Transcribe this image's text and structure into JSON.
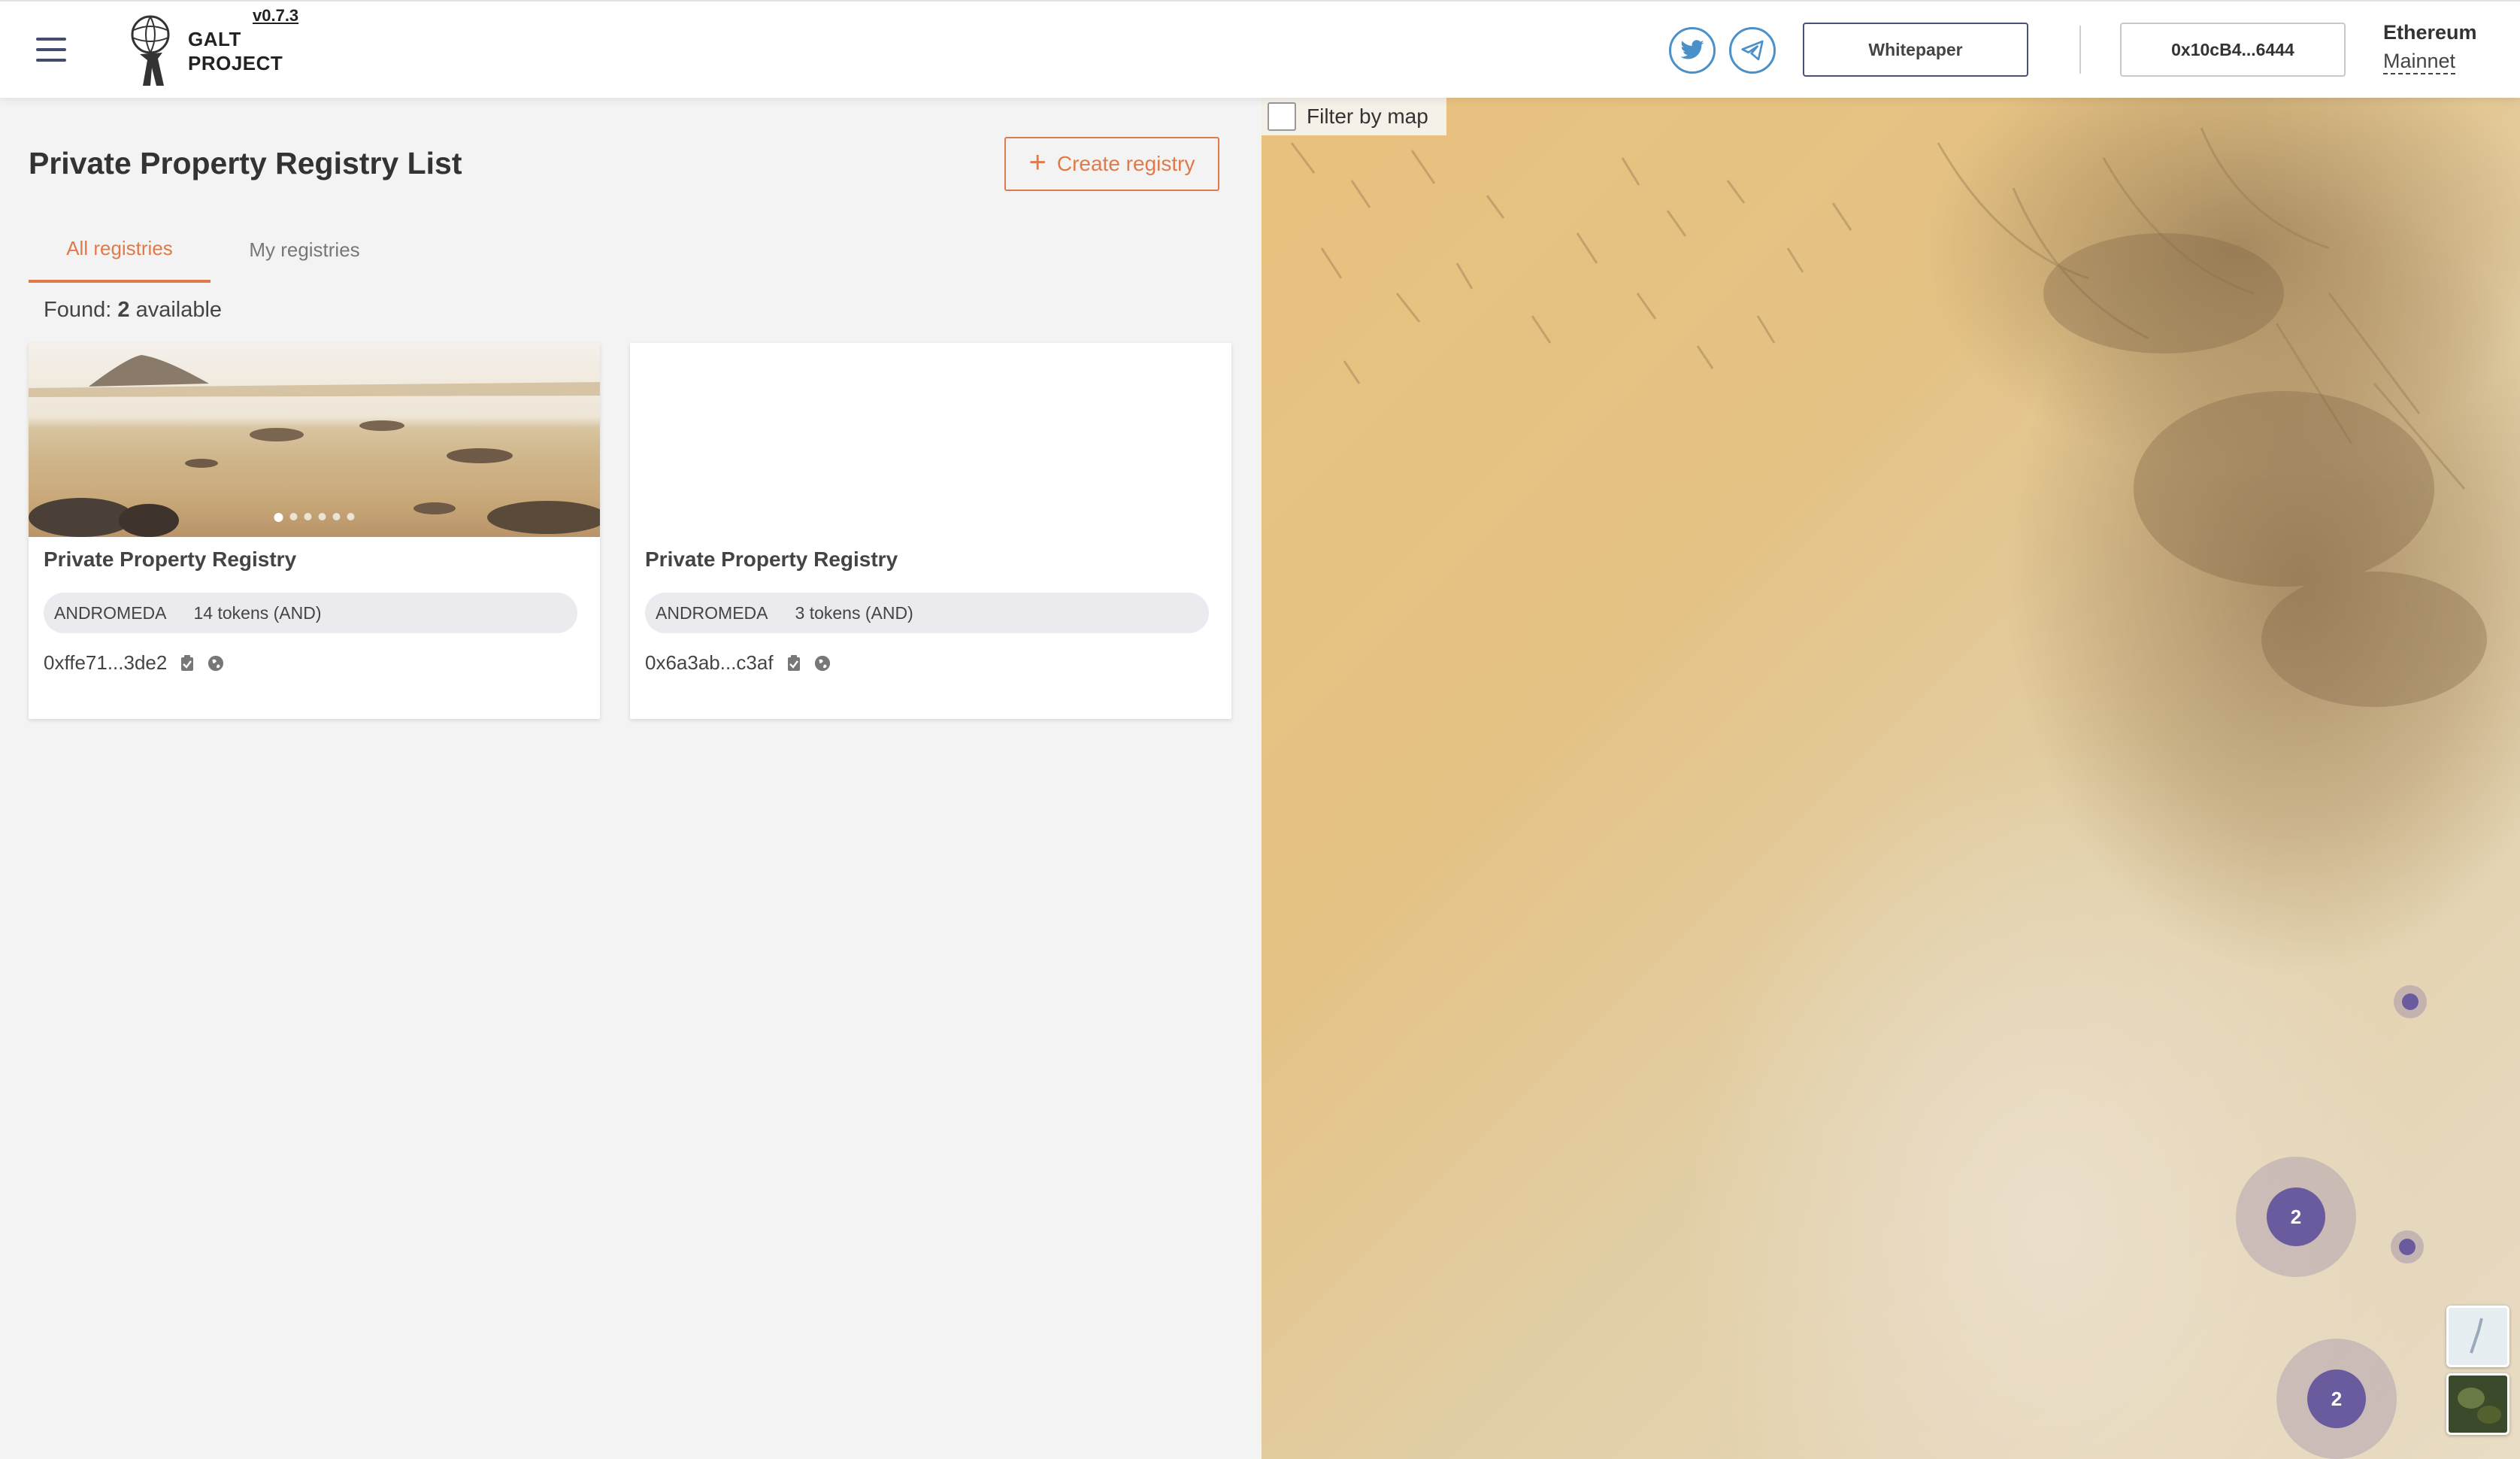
{
  "app": {
    "version": "v0.7.3",
    "logo_line1": "GALT",
    "logo_line2": "PROJECT"
  },
  "header": {
    "whitepaper_label": "Whitepaper",
    "account_label": "0x10cB4...6444",
    "network_title": "Ethereum",
    "network_name": "Mainnet",
    "icons": [
      "menu-icon",
      "twitter-icon",
      "telegram-icon"
    ]
  },
  "main": {
    "title": "Private Property Registry List",
    "create_label": "Create registry",
    "tabs": [
      {
        "label": "All registries",
        "active": true
      },
      {
        "label": "My registries",
        "active": false
      }
    ],
    "found_prefix": "Found:",
    "found_count": "2",
    "found_suffix": "available",
    "cards": [
      {
        "title": "Private Property Registry",
        "network": "ANDROMEDA",
        "tokens": "14 tokens (AND)",
        "address": "0xffe71...3de2",
        "has_image": true,
        "slides": 6
      },
      {
        "title": "Private Property Registry",
        "network": "ANDROMEDA",
        "tokens": "3 tokens (AND)",
        "address": "0x6a3ab...c3af",
        "has_image": false
      }
    ]
  },
  "map": {
    "filter_label": "Filter by map",
    "clusters": [
      {
        "count": "2"
      },
      {
        "count": "2"
      }
    ]
  },
  "colors": {
    "accent": "#e07a4a",
    "cluster": "#6a5a9e",
    "social": "#4a90c9"
  }
}
